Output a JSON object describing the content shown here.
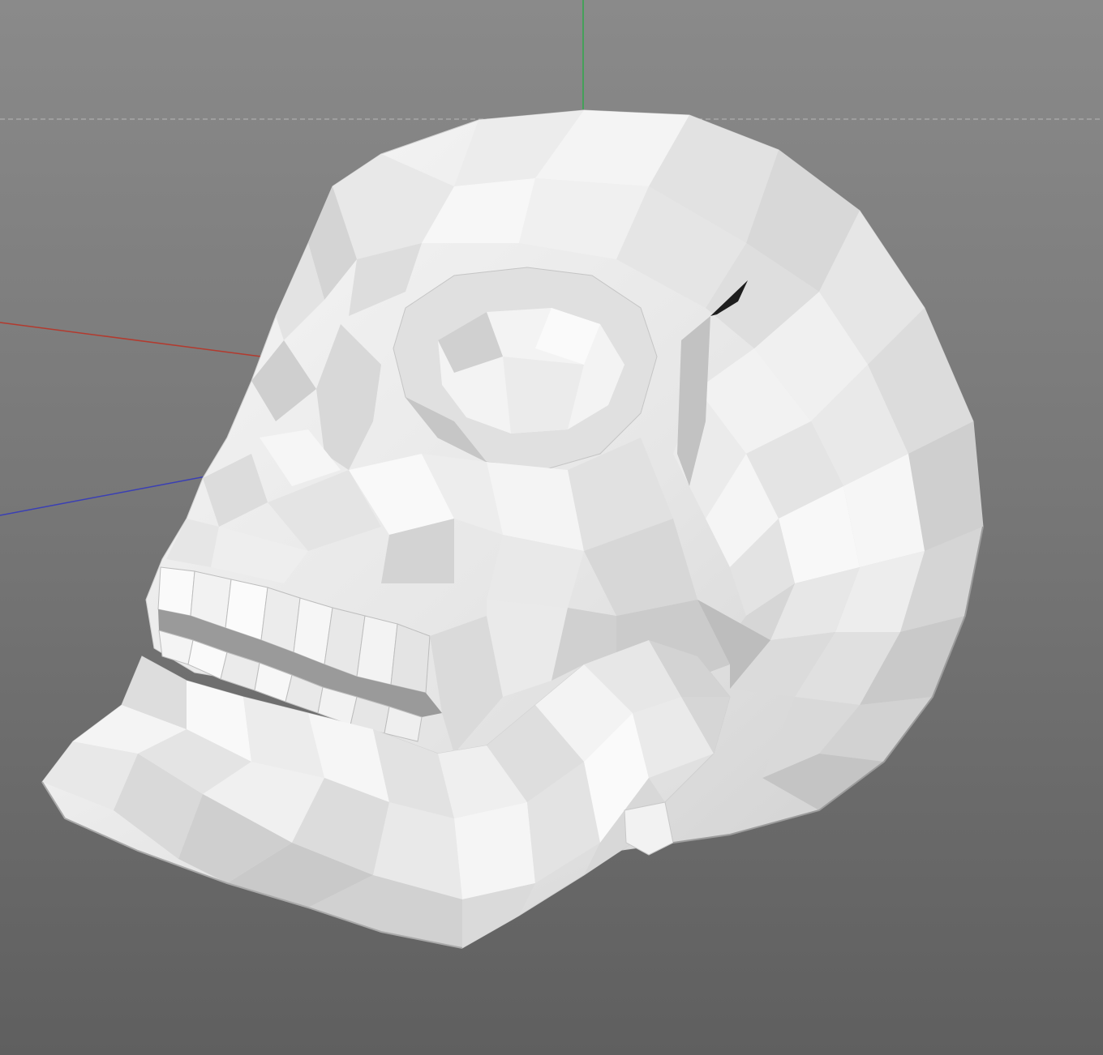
{
  "viewport": {
    "object": "low-poly-skull-model",
    "background_top": "#8a8a8a",
    "background_bottom": "#5f5f5f",
    "axes": {
      "x_color": "#b33a2e",
      "y_color": "#2fa84a",
      "z_color": "#3a3fb5"
    },
    "grid_line_color": "#a8a8a8",
    "model_color": "#f2f2f2"
  }
}
